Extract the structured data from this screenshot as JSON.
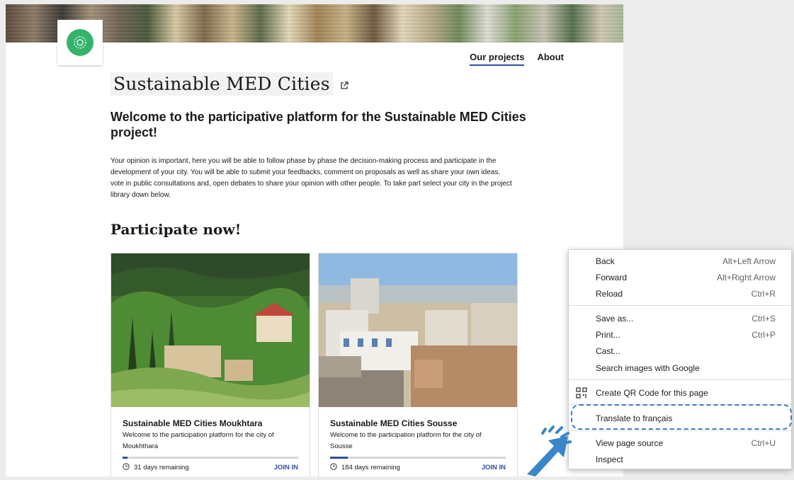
{
  "header": {
    "nav": [
      {
        "label": "Our projects"
      },
      {
        "label": "About"
      }
    ]
  },
  "main": {
    "title": "Sustainable MED Cities",
    "welcome": "Welcome to the participative platform for the Sustainable MED Cities project!",
    "intro": "Your opinion is important, here you will be able to follow phase by phase the decision-making process and participate in the development of your city. You will be able to submit your feedbacks, comment on proposals as well as share your own ideas, vote in public consultations and, open debates to share your opinion with other people. To take part select your city in the project library down below.",
    "participate_heading": "Participate now!"
  },
  "cards": [
    {
      "title": "Sustainable MED Cities Moukhtara",
      "description": "Welcome to the participation platform for the city of Moukhthara",
      "days": "31 days remaining",
      "join": "JOIN IN",
      "progress": 0.03
    },
    {
      "title": "Sustainable MED Cities Sousse",
      "description": "Welcome to the participation platform for the city of Sousse",
      "days": "184 days remaining",
      "join": "JOIN IN",
      "progress": 0.1
    }
  ],
  "context_menu": {
    "items": [
      {
        "label": "Back",
        "shortcut": "Alt+Left Arrow"
      },
      {
        "label": "Forward",
        "shortcut": "Alt+Right Arrow"
      },
      {
        "label": "Reload",
        "shortcut": "Ctrl+R"
      },
      {
        "label": "Save as...",
        "shortcut": "Ctrl+S"
      },
      {
        "label": "Print...",
        "shortcut": "Ctrl+P"
      },
      {
        "label": "Cast...",
        "shortcut": ""
      },
      {
        "label": "Search images with Google",
        "shortcut": ""
      },
      {
        "label": "Create QR Code for this page",
        "shortcut": ""
      },
      {
        "label": "Translate to français",
        "shortcut": ""
      },
      {
        "label": "View page source",
        "shortcut": "Ctrl+U"
      },
      {
        "label": "Inspect",
        "shortcut": ""
      }
    ]
  },
  "colors": {
    "accent": "#2c4fa3",
    "logo_green": "#35b36a",
    "highlight": "#3f7cc0"
  }
}
